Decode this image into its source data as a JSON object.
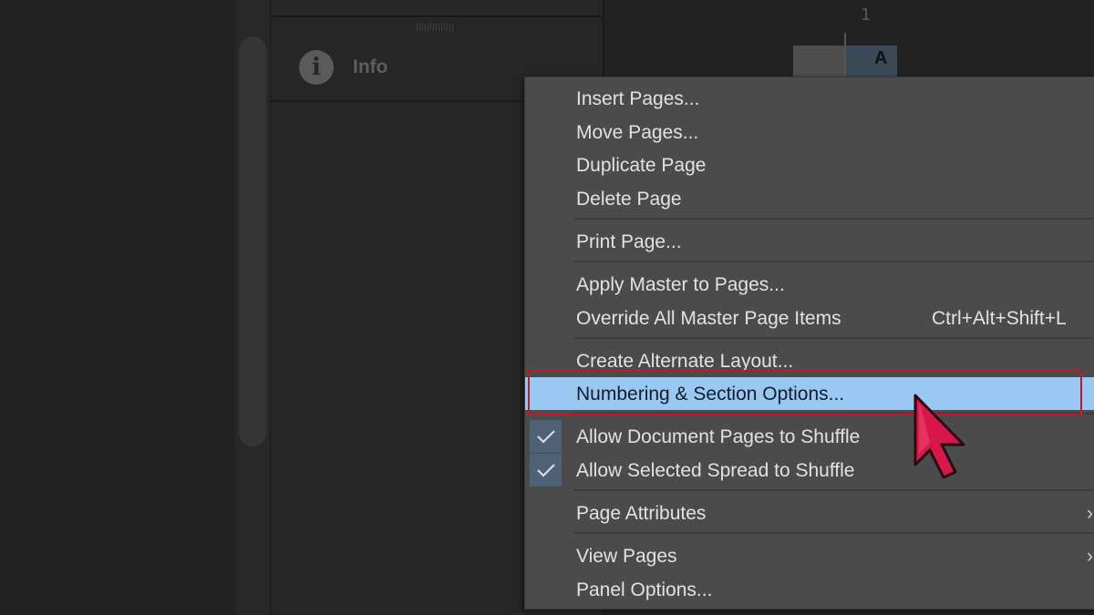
{
  "panel": {
    "info_label": "Info",
    "info_icon": "info-icon"
  },
  "pages_area": {
    "page_number": "1",
    "master_letter": "A"
  },
  "context_menu": {
    "items": [
      {
        "label": "Insert Pages..."
      },
      {
        "label": "Move Pages..."
      },
      {
        "label": "Duplicate Page"
      },
      {
        "label": "Delete Page"
      },
      {
        "label": "Print Page..."
      },
      {
        "label": "Apply Master to Pages..."
      },
      {
        "label": "Override All Master Page Items",
        "shortcut": "Ctrl+Alt+Shift+L"
      },
      {
        "label": "Create Alternate Layout..."
      },
      {
        "label": "Numbering & Section Options...",
        "highlighted": true
      },
      {
        "label": "Allow Document Pages to Shuffle",
        "checked": true
      },
      {
        "label": "Allow Selected Spread to Shuffle",
        "checked": true
      },
      {
        "label": "Page Attributes",
        "submenu_icon": "chevron-right-icon"
      },
      {
        "label": "View Pages",
        "submenu_icon": "chevron-right-icon"
      },
      {
        "label": "Panel Options..."
      }
    ],
    "highlight_color": "#99c8f2",
    "annotation_border_color": "#c0182e",
    "cursor_color": "#d7164a",
    "check_icon": "checkmark-icon"
  }
}
